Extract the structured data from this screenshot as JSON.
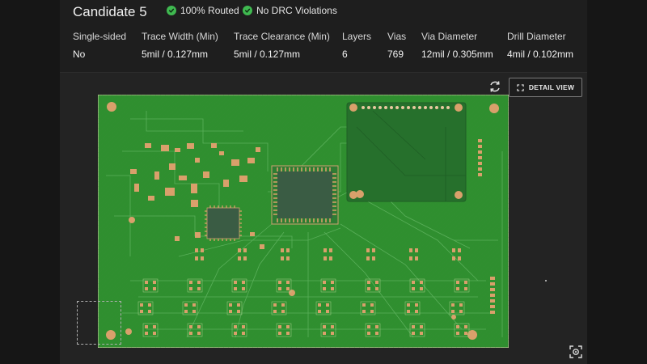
{
  "candidate": {
    "title": "Candidate 5",
    "badges": [
      "100% Routed",
      "No DRC Violations"
    ]
  },
  "stats": [
    {
      "label": "Single-sided",
      "value": "No"
    },
    {
      "label": "Trace Width (Min)",
      "value": "5mil / 0.127mm"
    },
    {
      "label": "Trace Clearance (Min)",
      "value": "5mil / 0.127mm"
    },
    {
      "label": "Layers",
      "value": "6"
    },
    {
      "label": "Vias",
      "value": "769"
    },
    {
      "label": "Via Diameter",
      "value": "12mil / 0.305mm"
    },
    {
      "label": "Drill Diameter",
      "value": "4mil / 0.102mm"
    }
  ],
  "viewer": {
    "detail_view_label": "DETAIL VIEW",
    "rotate_icon": "rotate-icon",
    "focus_icon": "focus-icon"
  },
  "colors": {
    "success": "#3fb950",
    "board": "#2f8f2f",
    "copper": "#d9a06b",
    "background": "#1e1e1e"
  }
}
